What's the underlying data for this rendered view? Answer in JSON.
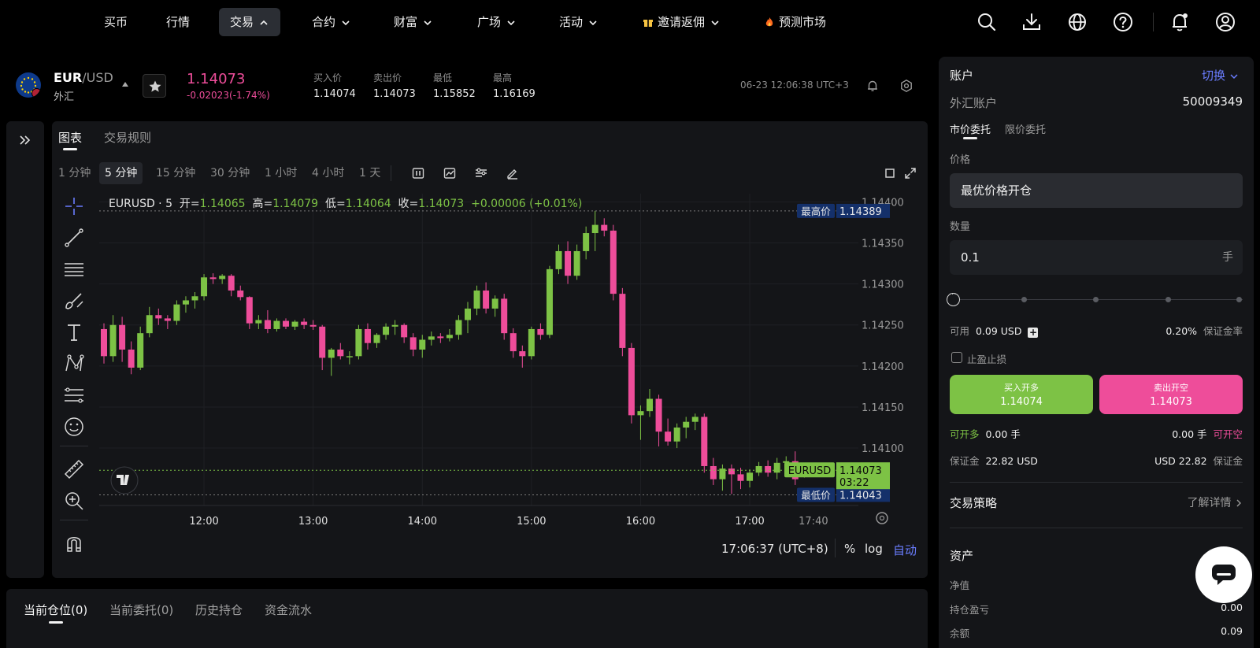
{
  "nav": {
    "items": [
      {
        "label": "买币",
        "chevron": false,
        "active": false
      },
      {
        "label": "行情",
        "chevron": false,
        "active": false
      },
      {
        "label": "交易",
        "chevron": true,
        "active": true
      },
      {
        "label": "合约",
        "chevron": true,
        "active": false
      },
      {
        "label": "财富",
        "chevron": true,
        "active": false
      },
      {
        "label": "广场",
        "chevron": true,
        "active": false
      },
      {
        "label": "活动",
        "chevron": true,
        "active": false
      },
      {
        "label": "邀请返佣",
        "chevron": true,
        "active": false,
        "icon": "gift-icon"
      },
      {
        "label": "预测市场",
        "chevron": false,
        "active": false,
        "icon": "fire-icon"
      }
    ],
    "right_icons": [
      "search-icon",
      "download-icon",
      "globe-icon",
      "help-icon",
      "bell-icon",
      "user-icon"
    ]
  },
  "symbol": {
    "base": "EUR",
    "quote": "/USD",
    "category": "外汇",
    "last_price": "1.14073",
    "change": "-0.02023(-1.74%)",
    "stats": [
      {
        "label": "买入价",
        "value": "1.14074"
      },
      {
        "label": "卖出价",
        "value": "1.14073"
      },
      {
        "label": "最低",
        "value": "1.15852"
      },
      {
        "label": "最高",
        "value": "1.16169"
      }
    ],
    "time": "06-23 12:06:38 UTC+3"
  },
  "chart_panel": {
    "tabs": [
      "图表",
      "交易规则"
    ],
    "timeframes": [
      "1 分钟",
      "5 分钟",
      "15 分钟",
      "30 分钟",
      "1 小时",
      "4 小时",
      "1 天"
    ],
    "active_timeframe": "5 分钟",
    "legend": {
      "symbol": "EURUSD · 5",
      "open_label": "开=",
      "open": "1.14065",
      "high_label": "高=",
      "high": "1.14079",
      "low_label": "低=",
      "low": "1.14064",
      "close_label": "收=",
      "close": "1.14073",
      "change": "+0.00006 (+0.01%)"
    },
    "footer_time": "17:06:37 (UTC+8)",
    "footer_pct": "%",
    "footer_log": "log",
    "footer_auto": "自动"
  },
  "chart_data": {
    "type": "candlestick",
    "x_ticks": [
      "12:00",
      "13:00",
      "14:00",
      "15:00",
      "16:00",
      "17:00",
      "17:40"
    ],
    "y_ticks": [
      "1.14400",
      "1.14350",
      "1.14300",
      "1.14250",
      "1.14200",
      "1.14150",
      "1.14100"
    ],
    "ylim": [
      1.1403,
      1.1441
    ],
    "high_marker": {
      "label": "最高价",
      "value": "1.14389"
    },
    "low_marker": {
      "label": "最低价",
      "value": "1.14043"
    },
    "current_marker": {
      "label": "EURUSD",
      "value": "1.14073",
      "countdown": "03:22"
    },
    "candles": [
      [
        1.14245,
        1.14252,
        1.14203,
        1.14212
      ],
      [
        1.14212,
        1.14262,
        1.14205,
        1.1425
      ],
      [
        1.1425,
        1.1426,
        1.14205,
        1.1422
      ],
      [
        1.1422,
        1.1423,
        1.1419,
        1.14198
      ],
      [
        1.14198,
        1.14248,
        1.14195,
        1.1424
      ],
      [
        1.1424,
        1.14272,
        1.14235,
        1.14262
      ],
      [
        1.14262,
        1.1427,
        1.1425,
        1.14258
      ],
      [
        1.14258,
        1.14262,
        1.14245,
        1.14255
      ],
      [
        1.14255,
        1.1428,
        1.1425,
        1.14275
      ],
      [
        1.14275,
        1.14285,
        1.14265,
        1.1428
      ],
      [
        1.1428,
        1.1429,
        1.1427,
        1.14285
      ],
      [
        1.14285,
        1.14312,
        1.1428,
        1.14308
      ],
      [
        1.14308,
        1.14313,
        1.143,
        1.14306
      ],
      [
        1.14306,
        1.14312,
        1.143,
        1.1431
      ],
      [
        1.1431,
        1.14312,
        1.14285,
        1.14292
      ],
      [
        1.14292,
        1.14298,
        1.1428,
        1.14284
      ],
      [
        1.14284,
        1.14285,
        1.14245,
        1.14252
      ],
      [
        1.14252,
        1.14262,
        1.14245,
        1.14256
      ],
      [
        1.14256,
        1.14268,
        1.1424,
        1.14245
      ],
      [
        1.14245,
        1.14258,
        1.14242,
        1.14255
      ],
      [
        1.14255,
        1.14258,
        1.14245,
        1.14248
      ],
      [
        1.14248,
        1.14256,
        1.14244,
        1.14254
      ],
      [
        1.14254,
        1.14258,
        1.14245,
        1.1425
      ],
      [
        1.1425,
        1.14256,
        1.14244,
        1.14248
      ],
      [
        1.14248,
        1.1425,
        1.14195,
        1.1421
      ],
      [
        1.1421,
        1.14222,
        1.14188,
        1.1422
      ],
      [
        1.1422,
        1.14228,
        1.14208,
        1.14212
      ],
      [
        1.14212,
        1.14218,
        1.14202,
        1.14212
      ],
      [
        1.14212,
        1.1425,
        1.14208,
        1.14245
      ],
      [
        1.14245,
        1.14252,
        1.1422,
        1.14228
      ],
      [
        1.14228,
        1.1424,
        1.14222,
        1.14238
      ],
      [
        1.14238,
        1.14252,
        1.14232,
        1.14248
      ],
      [
        1.14248,
        1.14256,
        1.14238,
        1.1425
      ],
      [
        1.1425,
        1.14252,
        1.14228,
        1.14235
      ],
      [
        1.14235,
        1.1424,
        1.14212,
        1.1422
      ],
      [
        1.1422,
        1.14238,
        1.1421,
        1.14232
      ],
      [
        1.14232,
        1.14242,
        1.14225,
        1.14236
      ],
      [
        1.14236,
        1.1424,
        1.14228,
        1.14234
      ],
      [
        1.14234,
        1.14245,
        1.1423,
        1.14238
      ],
      [
        1.14238,
        1.14262,
        1.14232,
        1.14256
      ],
      [
        1.14256,
        1.14278,
        1.1424,
        1.1427
      ],
      [
        1.1427,
        1.14298,
        1.14262,
        1.14292
      ],
      [
        1.14292,
        1.14302,
        1.14264,
        1.1427
      ],
      [
        1.1427,
        1.14286,
        1.1426,
        1.14282
      ],
      [
        1.14282,
        1.14288,
        1.14232,
        1.1424
      ],
      [
        1.1424,
        1.14246,
        1.1421,
        1.14218
      ],
      [
        1.14218,
        1.14225,
        1.14198,
        1.14212
      ],
      [
        1.14212,
        1.14248,
        1.14208,
        1.14245
      ],
      [
        1.14245,
        1.14252,
        1.14232,
        1.14238
      ],
      [
        1.14238,
        1.14322,
        1.14234,
        1.14318
      ],
      [
        1.14318,
        1.14348,
        1.14312,
        1.1434
      ],
      [
        1.1434,
        1.14352,
        1.143,
        1.1431
      ],
      [
        1.1431,
        1.14348,
        1.14305,
        1.1434
      ],
      [
        1.1434,
        1.1437,
        1.1433,
        1.14362
      ],
      [
        1.14362,
        1.14389,
        1.1434,
        1.14372
      ],
      [
        1.14372,
        1.1438,
        1.14358,
        1.14365
      ],
      [
        1.14365,
        1.14372,
        1.1428,
        1.14288
      ],
      [
        1.14288,
        1.14295,
        1.14212,
        1.14222
      ],
      [
        1.14222,
        1.14228,
        1.1413,
        1.1414
      ],
      [
        1.1414,
        1.14152,
        1.1411,
        1.14145
      ],
      [
        1.14145,
        1.14172,
        1.14138,
        1.1416
      ],
      [
        1.1416,
        1.14165,
        1.14102,
        1.1412
      ],
      [
        1.1412,
        1.14136,
        1.14103,
        1.14108
      ],
      [
        1.14108,
        1.1413,
        1.141,
        1.14125
      ],
      [
        1.14125,
        1.14138,
        1.14112,
        1.14132
      ],
      [
        1.14132,
        1.14142,
        1.14122,
        1.14138
      ],
      [
        1.14138,
        1.14142,
        1.1407,
        1.14078
      ],
      [
        1.14078,
        1.14088,
        1.14055,
        1.14062
      ],
      [
        1.14062,
        1.1408,
        1.14048,
        1.14075
      ],
      [
        1.14075,
        1.1408,
        1.14044,
        1.14068
      ],
      [
        1.14068,
        1.14076,
        1.1405,
        1.1406
      ],
      [
        1.1406,
        1.14074,
        1.14052,
        1.1407
      ],
      [
        1.1407,
        1.14083,
        1.14066,
        1.14078
      ],
      [
        1.14078,
        1.14085,
        1.14065,
        1.1407
      ],
      [
        1.1407,
        1.14088,
        1.14062,
        1.14082
      ],
      [
        1.14082,
        1.1409,
        1.14078,
        1.14084
      ],
      [
        1.14084,
        1.14096,
        1.14055,
        1.14062
      ],
      [
        1.14065,
        1.14079,
        1.14064,
        1.14073
      ]
    ]
  },
  "bottom_tabs": [
    "当前仓位(0)",
    "当前委托(0)",
    "历史持仓",
    "资金流水"
  ],
  "order_panel": {
    "account_label": "账户",
    "switch_label": "切换",
    "account_type": "外汇账户",
    "account_id": "50009349",
    "order_tabs": [
      "市价委托",
      "限价委托"
    ],
    "price_label": "价格",
    "price_value": "最优价格开仓",
    "qty_label": "数量",
    "qty_value": "0.1",
    "qty_unit": "手",
    "available_label": "可用",
    "available_value": "0.09 USD",
    "margin_rate_value": "0.20%",
    "margin_rate_label": "保证金率",
    "tp_sl_label": "止盈止损",
    "buy_label": "买入开多",
    "buy_price": "1.14074",
    "sell_label": "卖出开空",
    "sell_price": "1.14073",
    "can_long_label": "可开多",
    "can_long_value": "0.00 手",
    "can_short_value": "0.00 手",
    "can_short_label": "可开空",
    "margin_label": "保证金",
    "margin_left_value": "22.82 USD",
    "margin_right_value": "USD 22.82",
    "margin_right_label": "保证金",
    "strategy_label": "交易策略",
    "strategy_link": "了解详情",
    "assets_title": "资产",
    "assets": [
      {
        "label": "净值",
        "value": ""
      },
      {
        "label": "持仓盈亏",
        "value": "0.00"
      },
      {
        "label": "余额",
        "value": "0.09"
      }
    ]
  },
  "colors": {
    "up": "#7dc245",
    "down": "#ee4d9a",
    "accent": "#6a7dff",
    "panel": "#141518"
  }
}
